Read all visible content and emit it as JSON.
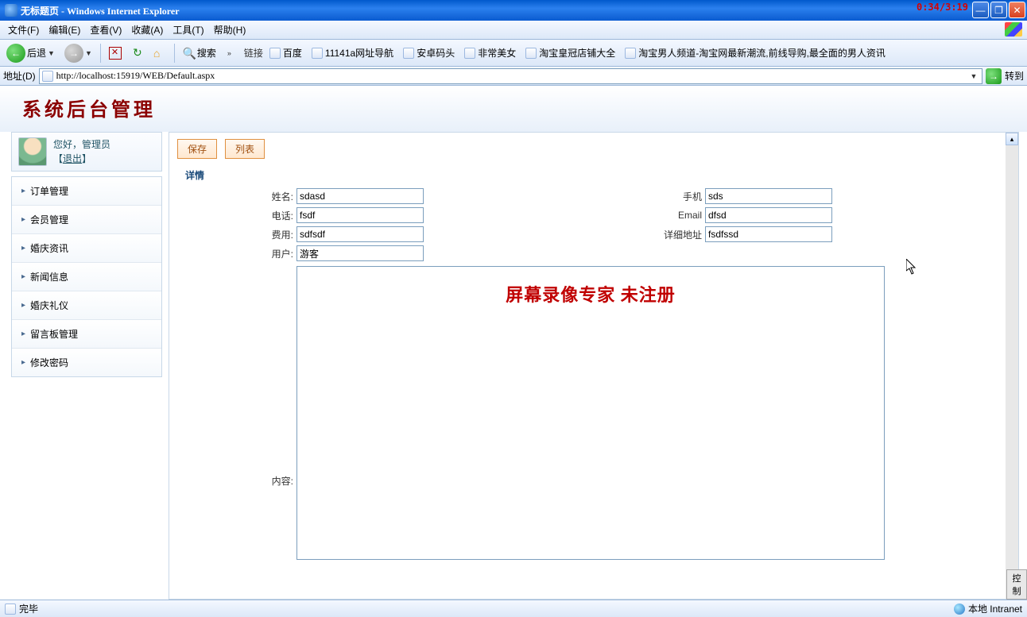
{
  "window": {
    "title": "无标题页 - Windows Internet Explorer",
    "timer": "0:34/3:19"
  },
  "menubar": {
    "file": "文件(F)",
    "edit": "编辑(E)",
    "view": "查看(V)",
    "favorites": "收藏(A)",
    "tools": "工具(T)",
    "help": "帮助(H)"
  },
  "toolbar": {
    "back": "后退",
    "search": "搜索",
    "links_label": "链接",
    "links": [
      "百度",
      "11141a网址导航",
      "安卓码头",
      "非常美女",
      "淘宝皇冠店铺大全",
      "淘宝男人频道-淘宝网最新潮流,前线导购,最全面的男人资讯"
    ]
  },
  "addressbar": {
    "label": "地址(D)",
    "url": "http://localhost:15919/WEB/Default.aspx",
    "go": "转到"
  },
  "page": {
    "title": "系统后台管理"
  },
  "userbox": {
    "greeting": "您好，管理员",
    "logout": "退出"
  },
  "sidebar": {
    "items": [
      "订单管理",
      "会员管理",
      "婚庆资讯",
      "新闻信息",
      "婚庆礼仪",
      "留言板管理",
      "修改密码"
    ]
  },
  "actions": {
    "save": "保存",
    "list": "列表"
  },
  "section": {
    "title": "详情"
  },
  "form": {
    "name_label": "姓名:",
    "name_value": "sdasd",
    "mobile_label": "手机",
    "mobile_value": "sds",
    "phone_label": "电话:",
    "phone_value": "fsdf",
    "email_label": "Email",
    "email_value": "dfsd",
    "fee_label": "费用:",
    "fee_value": "sdfsdf",
    "address_label": "详细地址",
    "address_value": "fsdfssd",
    "user_label": "用户:",
    "user_value": "游客",
    "content_label": "内容:"
  },
  "overlay": "屏幕录像专家  未注册",
  "statusbar": {
    "done": "完毕",
    "zone": "本地 Intranet",
    "control_tab": "控制"
  }
}
